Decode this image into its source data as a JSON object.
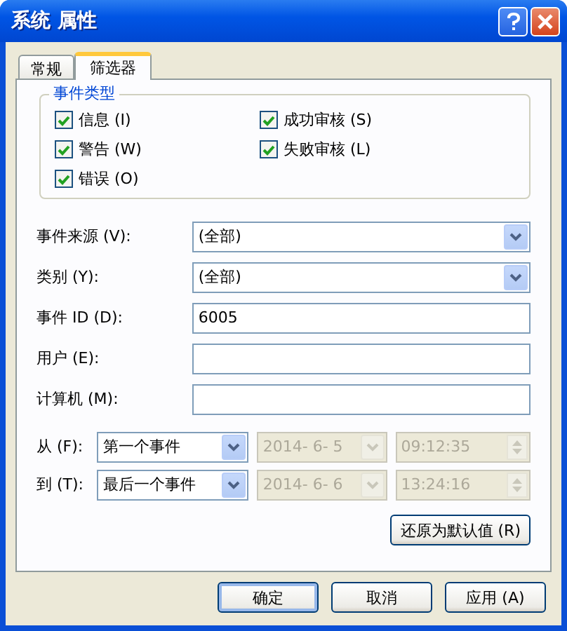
{
  "window": {
    "title": "系统 属性"
  },
  "tabs": [
    {
      "label": "常规",
      "selected": false
    },
    {
      "label": "筛选器",
      "selected": true
    }
  ],
  "event_types": {
    "title": "事件类型",
    "options": [
      {
        "label": "信息 (I)",
        "checked": true
      },
      {
        "label": "成功审核 (S)",
        "checked": true
      },
      {
        "label": "警告 (W)",
        "checked": true
      },
      {
        "label": "失败审核 (L)",
        "checked": true
      },
      {
        "label": "错误 (O)",
        "checked": true
      }
    ]
  },
  "fields": [
    {
      "label": "事件来源 (V):",
      "kind": "dropdown",
      "value": "(全部)"
    },
    {
      "label": "类别 (Y):",
      "kind": "dropdown",
      "value": "(全部)"
    },
    {
      "label": "事件 ID (D):",
      "kind": "text",
      "value": "6005"
    },
    {
      "label": "用户 (E):",
      "kind": "text"
    },
    {
      "label": "计算机 (M):",
      "kind": "text"
    }
  ],
  "range": [
    {
      "label": "从 (F):",
      "event": "第一个事件",
      "date": "2014- 6- 5",
      "time": "09:12:35",
      "disabled": true
    },
    {
      "label": "到 (T):",
      "event": "最后一个事件",
      "date": "2014- 6- 6",
      "time": "13:24:16",
      "disabled": true
    }
  ],
  "restore_button": "还原为默认值 (R)",
  "buttons": [
    {
      "label": "确定",
      "default": true
    },
    {
      "label": "取消",
      "default": false
    },
    {
      "label": "应用 (A)",
      "default": false
    }
  ]
}
